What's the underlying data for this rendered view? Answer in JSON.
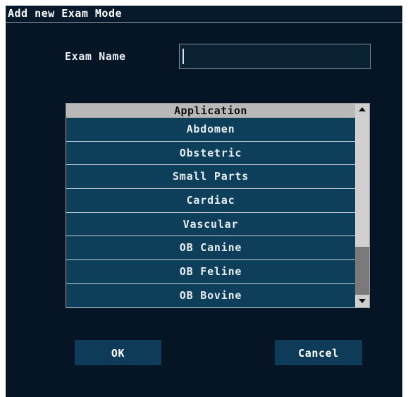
{
  "dialog": {
    "title": "Add new Exam Mode"
  },
  "exam_name": {
    "label": "Exam Name",
    "value": "",
    "placeholder": ""
  },
  "application_list": {
    "header": "Application",
    "items": [
      "Abdomen",
      "Obstetric",
      "Small Parts",
      "Cardiac",
      "Vascular",
      "OB Canine",
      "OB Feline",
      "OB Bovine"
    ],
    "scroll_position_fraction": 0.7
  },
  "buttons": {
    "ok": "OK",
    "cancel": "Cancel"
  },
  "colors": {
    "background": "#061525",
    "row": "#0d3f5b",
    "button": "#0e3b58",
    "header": "#b9b9b9",
    "scrollbar": "#d0d0d0",
    "scroll_thumb": "#7a7a7a"
  },
  "icons": {
    "scroll_up": "triangle-up-icon",
    "scroll_down": "triangle-down-icon"
  }
}
